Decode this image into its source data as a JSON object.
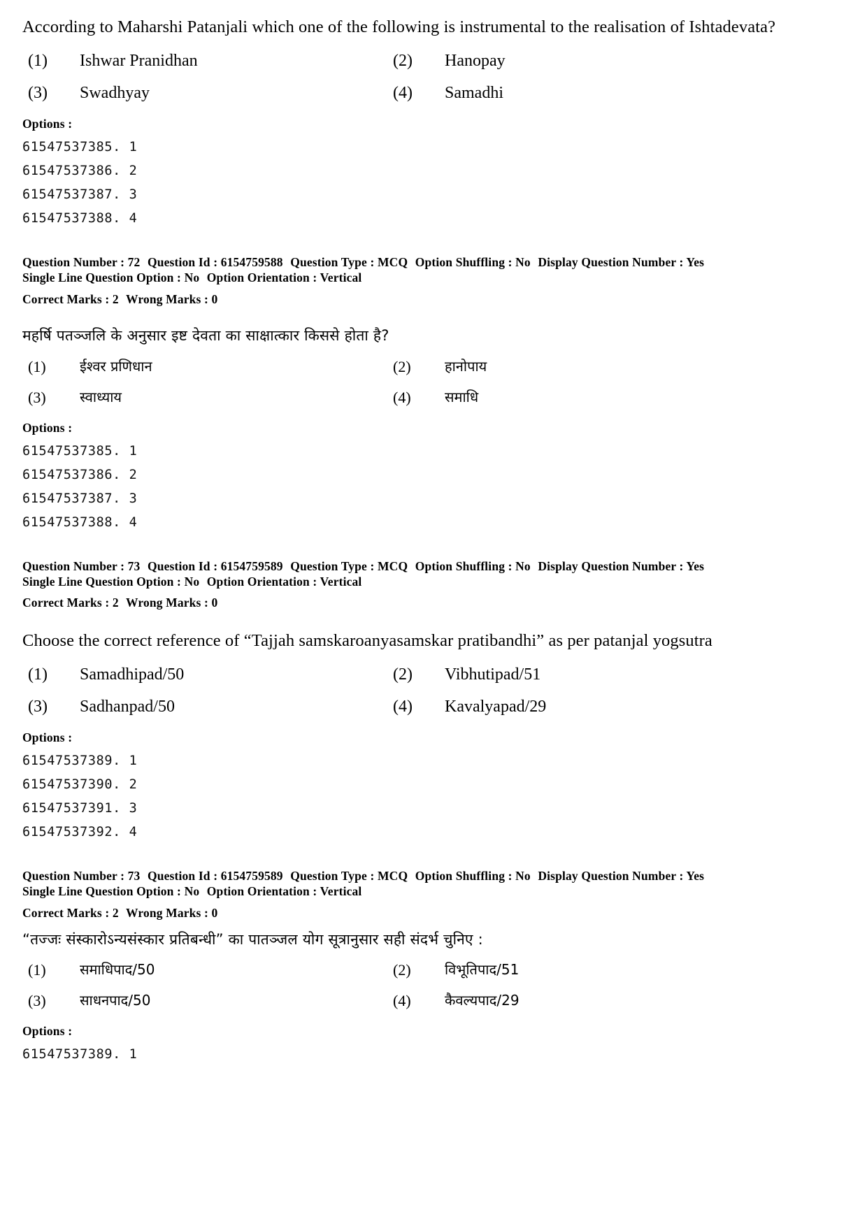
{
  "document": {
    "labels": {
      "options_heading": "Options :",
      "question_number": "Question Number :",
      "question_id": "Question Id :",
      "question_type": "Question Type :",
      "option_shuffling": "Option Shuffling :",
      "display_question_number": "Display Question Number :",
      "single_line_question_option": "Single Line Question Option :",
      "option_orientation": "Option Orientation :",
      "correct_marks": "Correct Marks :",
      "wrong_marks": "Wrong Marks :"
    }
  },
  "blocks": {
    "q72_en": {
      "text": "According to Maharshi Patanjali which one of the following is instrumental to the realisation of Ishtadevata?",
      "options": [
        {
          "num": "(1)",
          "value": "Ishwar Pranidhan"
        },
        {
          "num": "(2)",
          "value": "Hanopay"
        },
        {
          "num": "(3)",
          "value": "Swadhyay"
        },
        {
          "num": "(4)",
          "value": "Samadhi"
        }
      ],
      "option_ids": [
        "61547537385. 1",
        "61547537386. 2",
        "61547537387. 3",
        "61547537388. 4"
      ]
    },
    "q72_meta": {
      "question_number": "72",
      "question_id": "6154759588",
      "question_type": "MCQ",
      "option_shuffling": "No",
      "display_question_number": "Yes",
      "single_line_question_option": "No",
      "option_orientation": "Vertical",
      "correct_marks": "2",
      "wrong_marks": "0"
    },
    "q72_hi": {
      "text": "महर्षि पतञ्जलि के अनुसार इष्ट देवता का साक्षात्कार किससे होता है?",
      "options": [
        {
          "num": "(1)",
          "value": "ईश्वर प्रणिधान"
        },
        {
          "num": "(2)",
          "value": "हानोपाय"
        },
        {
          "num": "(3)",
          "value": "स्वाध्याय"
        },
        {
          "num": "(4)",
          "value": "समाधि"
        }
      ],
      "option_ids": [
        "61547537385. 1",
        "61547537386. 2",
        "61547537387. 3",
        "61547537388. 4"
      ]
    },
    "q73_meta_top": {
      "question_number": "73",
      "question_id": "6154759589",
      "question_type": "MCQ",
      "option_shuffling": "No",
      "display_question_number": "Yes",
      "single_line_question_option": "No",
      "option_orientation": "Vertical",
      "correct_marks": "2",
      "wrong_marks": "0"
    },
    "q73_en": {
      "text": "Choose the correct reference of “Tajjah samskaroanyasamskar pratibandhi” as per patanjal yogsutra",
      "options": [
        {
          "num": "(1)",
          "value": "Samadhipad/50"
        },
        {
          "num": "(2)",
          "value": "Vibhutipad/51"
        },
        {
          "num": "(3)",
          "value": "Sadhanpad/50"
        },
        {
          "num": "(4)",
          "value": "Kavalyapad/29"
        }
      ],
      "option_ids": [
        "61547537389. 1",
        "61547537390. 2",
        "61547537391. 3",
        "61547537392. 4"
      ]
    },
    "q73_meta_bottom": {
      "question_number": "73",
      "question_id": "6154759589",
      "question_type": "MCQ",
      "option_shuffling": "No",
      "display_question_number": "Yes",
      "single_line_question_option": "No",
      "option_orientation": "Vertical",
      "correct_marks": "2",
      "wrong_marks": "0"
    },
    "q73_hi": {
      "text": "“तज्जः संस्कारोऽन्यसंस्कार प्रतिबन्धी” का पातञ्जल योग सूत्रानुसार सही संदर्भ चुनिए :",
      "options": [
        {
          "num": "(1)",
          "value": "समाधिपाद/50"
        },
        {
          "num": "(2)",
          "value": "विभूतिपाद/51"
        },
        {
          "num": "(3)",
          "value": "साधनपाद/50"
        },
        {
          "num": "(4)",
          "value": "कैवल्यपाद/29"
        }
      ],
      "option_ids": [
        "61547537389. 1"
      ]
    }
  }
}
